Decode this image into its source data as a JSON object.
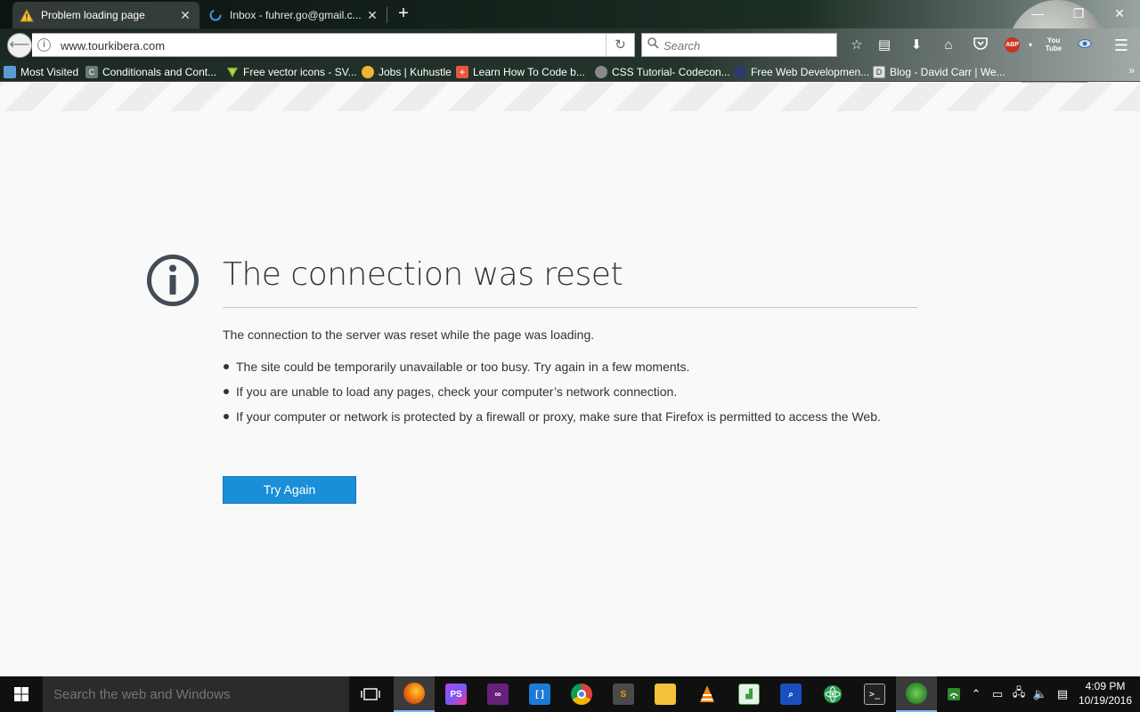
{
  "browser": {
    "tabs": [
      {
        "title": "Problem loading page",
        "icon": "warning-icon",
        "active": true
      },
      {
        "title": "Inbox - fuhrer.go@gmail.c...",
        "icon": "loading-spinner-icon",
        "active": false
      }
    ],
    "url": "www.tourkibera.com",
    "search_placeholder": "Search",
    "toolbar_icons": [
      "star-icon",
      "reading-list-icon",
      "download-icon",
      "home-icon",
      "pocket-icon",
      "adblock-plus-icon",
      "youtube-icon",
      "eye-icon",
      "menu-icon"
    ],
    "abp_label": "ABP",
    "youtube_label_1": "You",
    "youtube_label_2": "Tube",
    "bookmarks": [
      {
        "label": "Most Visited",
        "icon": "most-visited-icon",
        "color": "#5b9bd5"
      },
      {
        "label": "Conditionals and Cont...",
        "icon": "codecademy-icon",
        "color": "#6b7b73"
      },
      {
        "label": "Free vector icons - SV...",
        "icon": "flaticon-icon",
        "color": "#7fbf3f"
      },
      {
        "label": "Jobs | Kuhustle",
        "icon": "kuhustle-icon",
        "color": "#f2b233"
      },
      {
        "label": "Learn How To Code b...",
        "icon": "plus-cross-icon",
        "color": "#e8553e"
      },
      {
        "label": "CSS Tutorial- Codecon...",
        "icon": "globe-icon",
        "color": "#888888"
      },
      {
        "label": "Free Web Developmen...",
        "icon": "owl-icon",
        "color": "#2e3a6e"
      },
      {
        "label": "Blog - David Carr | We...",
        "icon": "page-icon",
        "color": "#e0e0e0"
      }
    ]
  },
  "error_page": {
    "title": "The connection was reset",
    "description": "The connection to the server was reset while the page was loading.",
    "bullets": [
      "The site could be temporarily unavailable or too busy. Try again in a few moments.",
      "If you are unable to load any pages, check your computer’s network connection.",
      "If your computer or network is protected by a firewall or proxy, make sure that Firefox is permitted to access the Web."
    ],
    "try_again_label": "Try Again",
    "accent_color": "#1a8ed6"
  },
  "taskbar": {
    "search_placeholder": "Search the web and Windows",
    "apps": [
      {
        "name": "task-view",
        "icon": "task-view-icon",
        "label": ""
      },
      {
        "name": "firefox",
        "icon": "firefox-icon",
        "label": "",
        "color": "#e66000",
        "active": true
      },
      {
        "name": "phpstorm",
        "icon": "phpstorm-icon",
        "label": "PS",
        "color": "#b345f1"
      },
      {
        "name": "visual-studio",
        "icon": "visual-studio-icon",
        "label": "",
        "color": "#68217a"
      },
      {
        "name": "brackets",
        "icon": "brackets-icon",
        "label": "[ ]",
        "color": "#1d7ad5"
      },
      {
        "name": "chrome",
        "icon": "chrome-icon",
        "label": "",
        "color": "#4285f4"
      },
      {
        "name": "sublime",
        "icon": "sublime-icon",
        "label": "S",
        "color": "#5a5a5a"
      },
      {
        "name": "file-explorer",
        "icon": "folder-icon",
        "label": "",
        "color": "#f3c13a"
      },
      {
        "name": "vlc",
        "icon": "vlc-icon",
        "label": "",
        "color": "#f28a0c"
      },
      {
        "name": "chart-app",
        "icon": "chart-app-icon",
        "label": "",
        "color": "#3f9b3f"
      },
      {
        "name": "search-app",
        "icon": "search-app-icon",
        "label": "",
        "color": "#1a4fbf"
      },
      {
        "name": "atom",
        "icon": "atom-icon",
        "label": "",
        "color": "#2da14f"
      },
      {
        "name": "terminal",
        "icon": "terminal-icon",
        "label": "",
        "color": "#222222"
      },
      {
        "name": "network-app",
        "icon": "network-globe-icon",
        "label": "",
        "color": "#3a8f2a",
        "active": true
      }
    ],
    "tray_icons": [
      "wifi-icon",
      "chevron-up-icon",
      "battery-icon",
      "network-icon",
      "volume-icon",
      "notification-icon"
    ],
    "time": "4:09 PM",
    "date": "10/19/2016"
  }
}
